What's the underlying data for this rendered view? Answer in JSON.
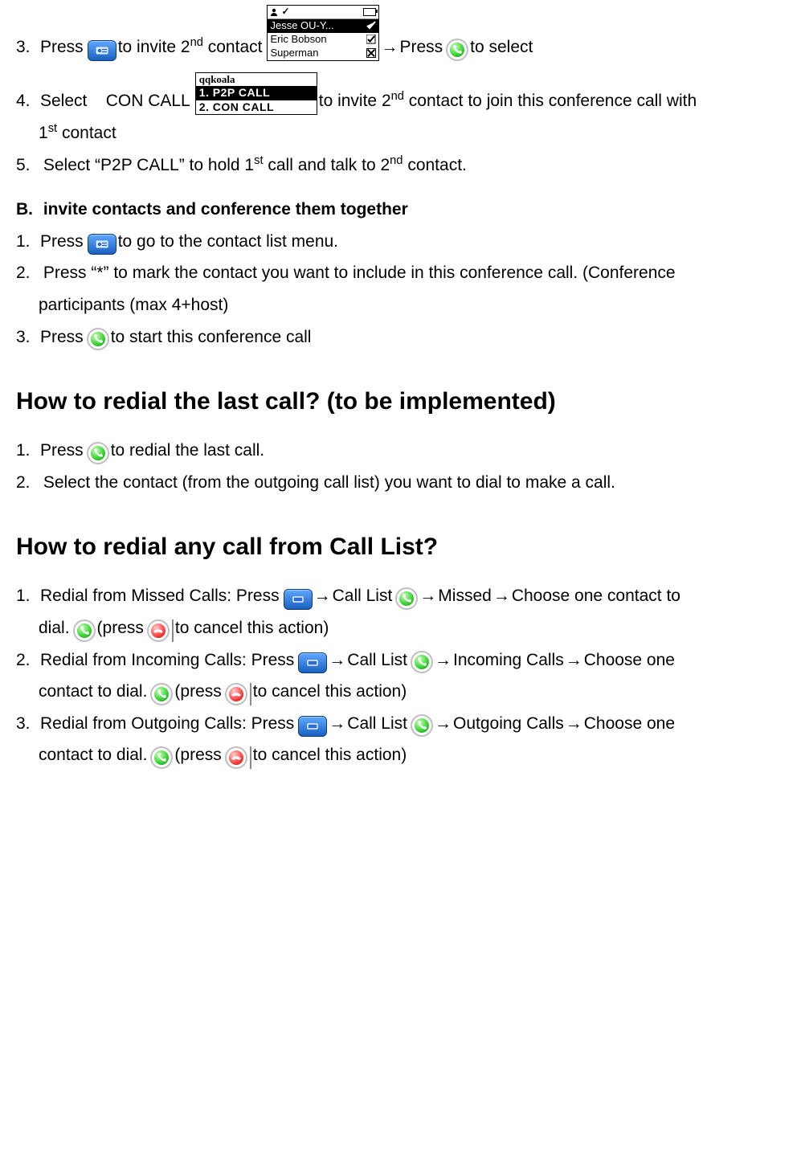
{
  "step3": {
    "num": "3.",
    "t1": "Press",
    "t2": "to invite 2",
    "sup1": "nd",
    "t3": " contact",
    "arrow": "→",
    "t4": " Press",
    "t5": "to select"
  },
  "contacts_screen": {
    "names": [
      "Jesse OU-Y...",
      "Eric Bobson",
      "Superman"
    ]
  },
  "step4": {
    "num": "4.",
    "t1": "Select    CON CALL",
    "t2": "to invite 2",
    "sup1": "nd",
    "t3": " contact to join this conference call with",
    "cont1": "1",
    "cont_sup": "st",
    "cont2": " contact"
  },
  "menu_screen": {
    "title": "qqkoala",
    "r1": "1. P2P CALL",
    "r2": "2. CON CALL"
  },
  "step5": {
    "num": "5.",
    "t1": "Select “P2P CALL” to hold 1",
    "sup1": "st",
    "t2": " call and talk to 2",
    "sup2": "nd",
    "t3": " contact."
  },
  "secB": {
    "num": "B.",
    "title": "invite contacts and conference them together"
  },
  "b1": {
    "num": "1.",
    "t1": "Press",
    "t2": "to go to the contact list menu."
  },
  "b2": {
    "num": "2.",
    "t1": "Press “*” to mark the contact you want to include in this conference call. (Conference",
    "cont": "participants (max 4+host)"
  },
  "b3": {
    "num": "3.",
    "t1": "Press",
    "t2": "to start this conference call"
  },
  "h_redial": "How to redial the last call? (to be implemented)",
  "r1": {
    "num": "1.",
    "t1": "Press",
    "t2": "to redial the last call."
  },
  "r2": {
    "num": "2.",
    "t1": "Select the contact (from the outgoing call list) you want to dial to make a call."
  },
  "h_calllist": "How to redial any call from Call List?",
  "cl_common": {
    "arrow": "→",
    "call_list": "Call List",
    "press_open": " (press",
    "cancel": " to cancel this action)"
  },
  "cl1": {
    "num": "1.",
    "t1": "Redial from Missed Calls: Press",
    "t2": "Missed",
    "t3": "Choose one contact to",
    "cont": "dial."
  },
  "cl2": {
    "num": "2.",
    "t1": "Redial from Incoming Calls: Press",
    "t2": "Incoming Calls",
    "t3": "Choose one",
    "cont": "contact to dial."
  },
  "cl3": {
    "num": "3.",
    "t1": "Redial from Outgoing Calls: Press",
    "t2": "Outgoing Calls",
    "t3": "Choose one",
    "cont": "contact to dial."
  }
}
